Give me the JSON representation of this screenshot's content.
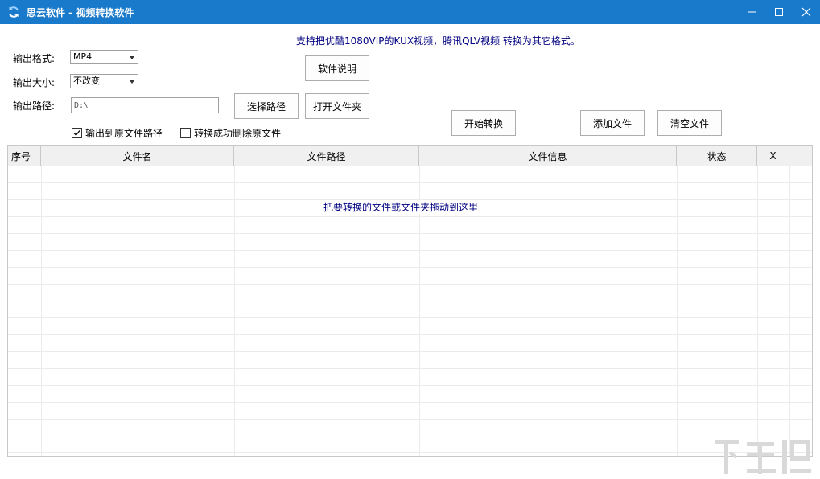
{
  "window": {
    "title": "思云软件 - 视频转换软件",
    "icon": "refresh-icon",
    "controls": [
      "minimize-icon",
      "maximize-icon",
      "close-icon"
    ],
    "titlebar_color": "#1979ca"
  },
  "info_text": "支持把优酷1080VIP的KUX视频，腾讯QLV视频 转换为其它格式。",
  "form": {
    "format_label": "输出格式:",
    "format_value": "MP4",
    "size_label": "输出大小:",
    "size_value": "不改变",
    "path_label": "输出路径:",
    "path_value": "D:\\"
  },
  "buttons": {
    "help": "软件说明",
    "choose_path": "选择路径",
    "open_folder": "打开文件夹",
    "start": "开始转换",
    "add_files": "添加文件",
    "clear_files": "清空文件"
  },
  "options": [
    {
      "label": "输出到原文件路径",
      "checked": true
    },
    {
      "label": "转换成功删除原文件",
      "checked": false
    }
  ],
  "table": {
    "columns": [
      "序号",
      "文件名",
      "文件路径",
      "文件信息",
      "状态",
      "X"
    ],
    "rows": [],
    "drop_hint": "把要转换的文件或文件夹拖动到这里"
  },
  "watermark": "下载吧"
}
